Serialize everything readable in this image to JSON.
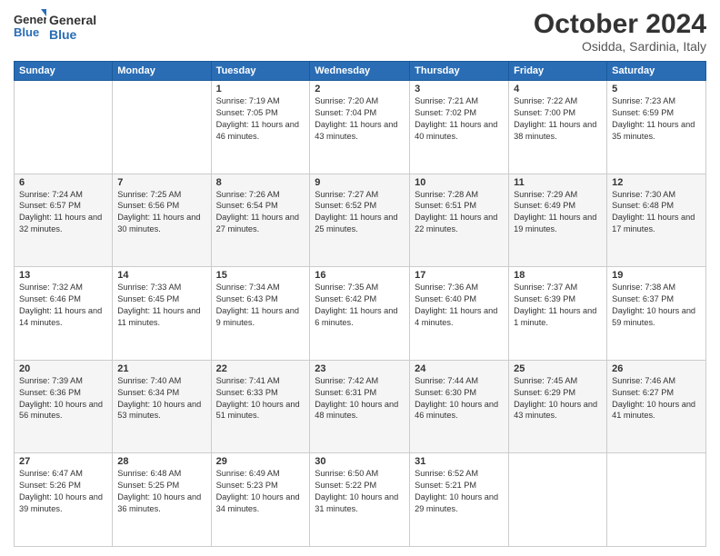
{
  "logo": {
    "general": "General",
    "blue": "Blue"
  },
  "header": {
    "month_year": "October 2024",
    "location": "Osidda, Sardinia, Italy"
  },
  "weekdays": [
    "Sunday",
    "Monday",
    "Tuesday",
    "Wednesday",
    "Thursday",
    "Friday",
    "Saturday"
  ],
  "weeks": [
    [
      {
        "day": "",
        "info": ""
      },
      {
        "day": "",
        "info": ""
      },
      {
        "day": "1",
        "info": "Sunrise: 7:19 AM\nSunset: 7:05 PM\nDaylight: 11 hours and 46 minutes."
      },
      {
        "day": "2",
        "info": "Sunrise: 7:20 AM\nSunset: 7:04 PM\nDaylight: 11 hours and 43 minutes."
      },
      {
        "day": "3",
        "info": "Sunrise: 7:21 AM\nSunset: 7:02 PM\nDaylight: 11 hours and 40 minutes."
      },
      {
        "day": "4",
        "info": "Sunrise: 7:22 AM\nSunset: 7:00 PM\nDaylight: 11 hours and 38 minutes."
      },
      {
        "day": "5",
        "info": "Sunrise: 7:23 AM\nSunset: 6:59 PM\nDaylight: 11 hours and 35 minutes."
      }
    ],
    [
      {
        "day": "6",
        "info": "Sunrise: 7:24 AM\nSunset: 6:57 PM\nDaylight: 11 hours and 32 minutes."
      },
      {
        "day": "7",
        "info": "Sunrise: 7:25 AM\nSunset: 6:56 PM\nDaylight: 11 hours and 30 minutes."
      },
      {
        "day": "8",
        "info": "Sunrise: 7:26 AM\nSunset: 6:54 PM\nDaylight: 11 hours and 27 minutes."
      },
      {
        "day": "9",
        "info": "Sunrise: 7:27 AM\nSunset: 6:52 PM\nDaylight: 11 hours and 25 minutes."
      },
      {
        "day": "10",
        "info": "Sunrise: 7:28 AM\nSunset: 6:51 PM\nDaylight: 11 hours and 22 minutes."
      },
      {
        "day": "11",
        "info": "Sunrise: 7:29 AM\nSunset: 6:49 PM\nDaylight: 11 hours and 19 minutes."
      },
      {
        "day": "12",
        "info": "Sunrise: 7:30 AM\nSunset: 6:48 PM\nDaylight: 11 hours and 17 minutes."
      }
    ],
    [
      {
        "day": "13",
        "info": "Sunrise: 7:32 AM\nSunset: 6:46 PM\nDaylight: 11 hours and 14 minutes."
      },
      {
        "day": "14",
        "info": "Sunrise: 7:33 AM\nSunset: 6:45 PM\nDaylight: 11 hours and 11 minutes."
      },
      {
        "day": "15",
        "info": "Sunrise: 7:34 AM\nSunset: 6:43 PM\nDaylight: 11 hours and 9 minutes."
      },
      {
        "day": "16",
        "info": "Sunrise: 7:35 AM\nSunset: 6:42 PM\nDaylight: 11 hours and 6 minutes."
      },
      {
        "day": "17",
        "info": "Sunrise: 7:36 AM\nSunset: 6:40 PM\nDaylight: 11 hours and 4 minutes."
      },
      {
        "day": "18",
        "info": "Sunrise: 7:37 AM\nSunset: 6:39 PM\nDaylight: 11 hours and 1 minute."
      },
      {
        "day": "19",
        "info": "Sunrise: 7:38 AM\nSunset: 6:37 PM\nDaylight: 10 hours and 59 minutes."
      }
    ],
    [
      {
        "day": "20",
        "info": "Sunrise: 7:39 AM\nSunset: 6:36 PM\nDaylight: 10 hours and 56 minutes."
      },
      {
        "day": "21",
        "info": "Sunrise: 7:40 AM\nSunset: 6:34 PM\nDaylight: 10 hours and 53 minutes."
      },
      {
        "day": "22",
        "info": "Sunrise: 7:41 AM\nSunset: 6:33 PM\nDaylight: 10 hours and 51 minutes."
      },
      {
        "day": "23",
        "info": "Sunrise: 7:42 AM\nSunset: 6:31 PM\nDaylight: 10 hours and 48 minutes."
      },
      {
        "day": "24",
        "info": "Sunrise: 7:44 AM\nSunset: 6:30 PM\nDaylight: 10 hours and 46 minutes."
      },
      {
        "day": "25",
        "info": "Sunrise: 7:45 AM\nSunset: 6:29 PM\nDaylight: 10 hours and 43 minutes."
      },
      {
        "day": "26",
        "info": "Sunrise: 7:46 AM\nSunset: 6:27 PM\nDaylight: 10 hours and 41 minutes."
      }
    ],
    [
      {
        "day": "27",
        "info": "Sunrise: 6:47 AM\nSunset: 5:26 PM\nDaylight: 10 hours and 39 minutes."
      },
      {
        "day": "28",
        "info": "Sunrise: 6:48 AM\nSunset: 5:25 PM\nDaylight: 10 hours and 36 minutes."
      },
      {
        "day": "29",
        "info": "Sunrise: 6:49 AM\nSunset: 5:23 PM\nDaylight: 10 hours and 34 minutes."
      },
      {
        "day": "30",
        "info": "Sunrise: 6:50 AM\nSunset: 5:22 PM\nDaylight: 10 hours and 31 minutes."
      },
      {
        "day": "31",
        "info": "Sunrise: 6:52 AM\nSunset: 5:21 PM\nDaylight: 10 hours and 29 minutes."
      },
      {
        "day": "",
        "info": ""
      },
      {
        "day": "",
        "info": ""
      }
    ]
  ]
}
